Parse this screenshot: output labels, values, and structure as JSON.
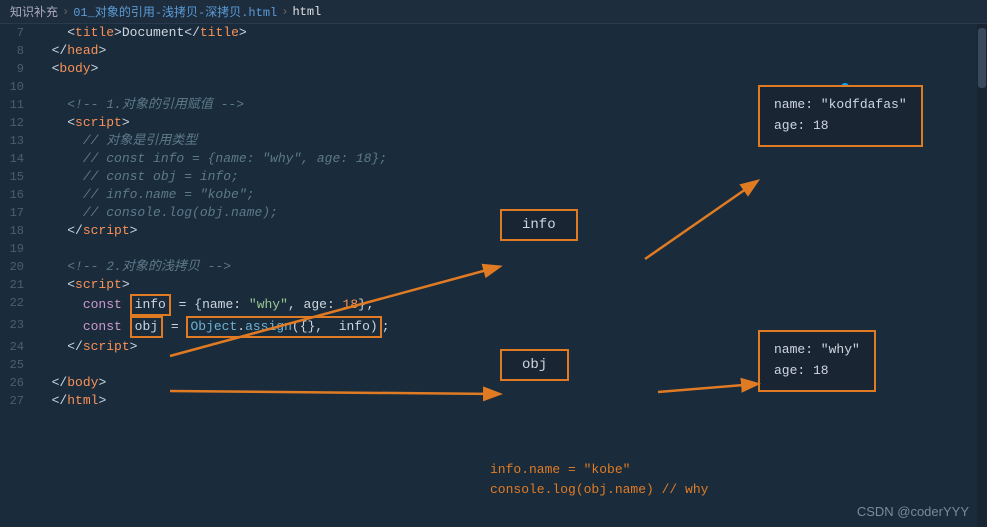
{
  "breadcrumb": {
    "items": [
      "知识补充",
      ">",
      "01_对象的引用-浅拷贝-深拷贝.html",
      ">",
      "html"
    ]
  },
  "lines": [
    {
      "num": "7",
      "content": "    <title>Document</title>"
    },
    {
      "num": "8",
      "content": "  </head>"
    },
    {
      "num": "9",
      "content": "  <body>"
    },
    {
      "num": "10",
      "content": ""
    },
    {
      "num": "11",
      "content": "    <!-- 1.对象的引用赋值 -->"
    },
    {
      "num": "12",
      "content": "    <script>"
    },
    {
      "num": "13",
      "content": "      // 对象是引用类型"
    },
    {
      "num": "14",
      "content": "      // const info = {name: \"why\", age: 18};"
    },
    {
      "num": "15",
      "content": "      // const obj = info;"
    },
    {
      "num": "16",
      "content": "      // info.name = \"kobe\";"
    },
    {
      "num": "17",
      "content": "      // console.log(obj.name);"
    },
    {
      "num": "18",
      "content": "    <\\/script>"
    },
    {
      "num": "19",
      "content": ""
    },
    {
      "num": "20",
      "content": "    <!-- 2.对象的浅拷贝 -->"
    },
    {
      "num": "21",
      "content": "    <script>"
    },
    {
      "num": "22",
      "content": "      const info = {name: \"why\", age: 18};"
    },
    {
      "num": "23",
      "content": "      const obj = Object.assign({},  info);"
    },
    {
      "num": "24",
      "content": "    <\\/script>"
    },
    {
      "num": "25",
      "content": ""
    },
    {
      "num": "26",
      "content": "  </body>"
    },
    {
      "num": "27",
      "content": "  </html>"
    }
  ],
  "annotations": {
    "info_label": "info",
    "obj_label": "obj",
    "info_content_line1": "name: \"kodfdafas\"",
    "info_content_line2": "age: 18",
    "obj_content_line1": "name: \"why\"",
    "obj_content_line2": "age: 18",
    "bottom_line1": "info.name = \"kobe\"",
    "bottom_line2": "console.log(obj.name) // why"
  },
  "watermark": "CSDN @coderYYY",
  "colors": {
    "orange": "#e07b24",
    "bg": "#1a2b3c",
    "border": "#e07b24"
  }
}
